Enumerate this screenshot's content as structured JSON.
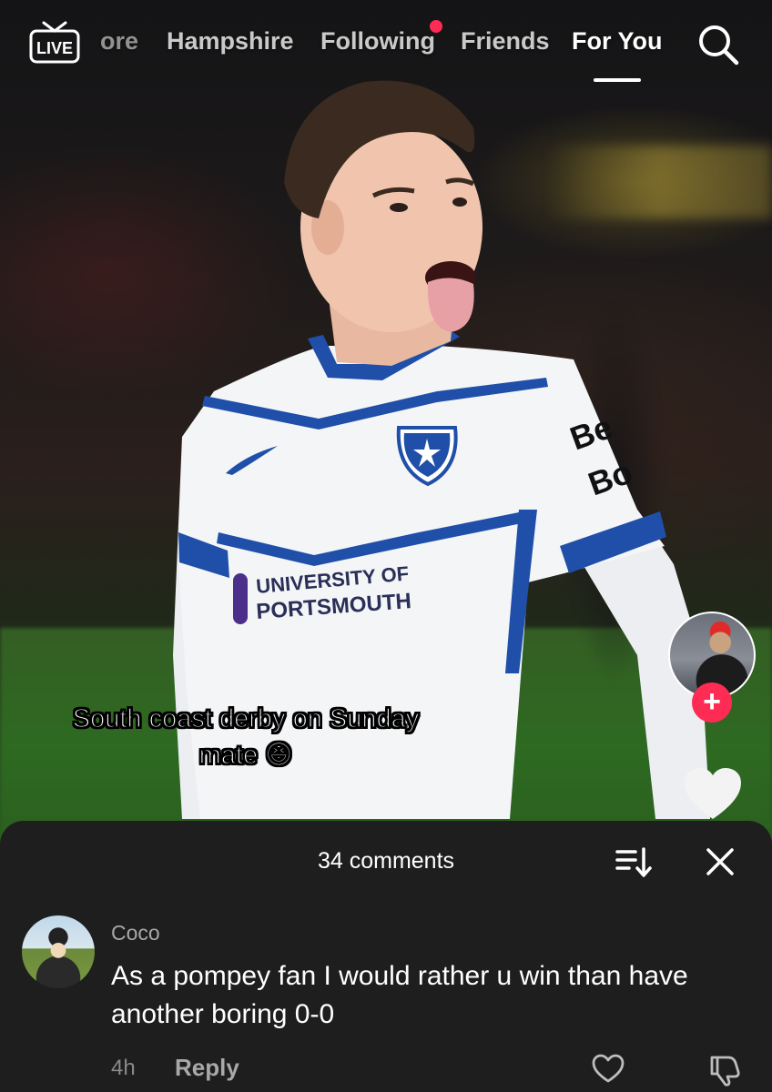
{
  "top_nav": {
    "live_label": "LIVE",
    "tabs": [
      {
        "label": "ore",
        "state": "faded"
      },
      {
        "label": "Hampshire",
        "state": "normal"
      },
      {
        "label": "Following",
        "state": "normal",
        "has_notification_dot": true
      },
      {
        "label": "Friends",
        "state": "normal"
      },
      {
        "label": "For You",
        "state": "active"
      }
    ],
    "search_icon": "search-icon"
  },
  "video": {
    "caption_line1": "South coast derby on Sunday",
    "caption_line2": "mate 😆",
    "shirt_sponsor_line1": "UNIVERSITY OF",
    "shirt_sponsor_line2": "PORTSMOUTH",
    "sleeve_text_1": "Be",
    "sleeve_text_2": "Bo"
  },
  "right_rail": {
    "creator_avatar": "creator-avatar",
    "follow_symbol": "+",
    "like_icon": "heart-icon"
  },
  "comments_sheet": {
    "title": "34 comments",
    "sort_icon": "sort-icon",
    "close_icon": "close-icon",
    "comments": [
      {
        "author": "Coco",
        "text": "As a pompey fan I would rather u win than have another boring 0-0",
        "time": "4h",
        "reply_label": "Reply"
      }
    ]
  },
  "colors": {
    "accent": "#fe2c55",
    "sheet_bg": "#1e1e1e",
    "kit_blue": "#1f4fa8",
    "kit_white": "#f4f5f7"
  }
}
